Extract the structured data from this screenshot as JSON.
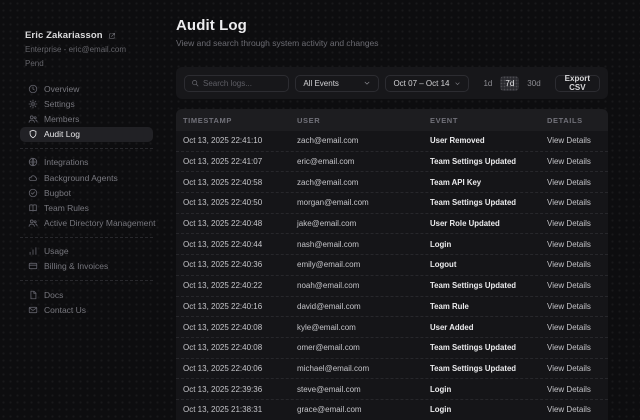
{
  "colors": {
    "page_bg": "#0d0d0f",
    "card_bg": "#17171a",
    "table_bg": "#151518",
    "table_header_bg": "#1d1d20",
    "active_item_bg": "#212125",
    "text_primary": "#ededef",
    "text_muted": "#6b6b72"
  },
  "sidebar": {
    "profile": {
      "name": "Eric Zakariasson",
      "org": "Enterprise - eric@email.com",
      "plan": "Pend"
    },
    "groups": [
      {
        "items": [
          {
            "label": "Overview",
            "icon": "clock-icon"
          },
          {
            "label": "Settings",
            "icon": "gear-icon"
          },
          {
            "label": "Members",
            "icon": "users-icon"
          },
          {
            "label": "Audit Log",
            "icon": "shield-icon",
            "active": true
          }
        ]
      },
      {
        "items": [
          {
            "label": "Integrations",
            "icon": "globe-icon"
          },
          {
            "label": "Background Agents",
            "icon": "cloud-icon"
          },
          {
            "label": "Bugbot",
            "icon": "check-circle-icon"
          },
          {
            "label": "Team Rules",
            "icon": "book-icon"
          },
          {
            "label": "Active Directory Management",
            "icon": "users-icon"
          }
        ]
      },
      {
        "items": [
          {
            "label": "Usage",
            "icon": "bar-chart-icon"
          },
          {
            "label": "Billing & Invoices",
            "icon": "credit-card-icon"
          }
        ]
      },
      {
        "items": [
          {
            "label": "Docs",
            "icon": "file-icon"
          },
          {
            "label": "Contact Us",
            "icon": "mail-icon"
          }
        ]
      }
    ]
  },
  "header": {
    "title": "Audit Log",
    "subtitle": "View and search through system activity and changes"
  },
  "toolbar": {
    "search_placeholder": "Search logs...",
    "event_filter_value": "All Events",
    "date_range": "Oct 07 – Oct 14",
    "range_buttons": [
      "1d",
      "7d",
      "30d"
    ],
    "active_range": "7d",
    "export_label": "Export CSV"
  },
  "table": {
    "columns": [
      "Timestamp",
      "User",
      "Event",
      "Details"
    ],
    "details_label": "View Details",
    "rows": [
      {
        "timestamp": "Oct 13, 2025 22:41:10",
        "user": "zach@email.com",
        "event": "User Removed"
      },
      {
        "timestamp": "Oct 13, 2025 22:41:07",
        "user": "eric@email.com",
        "event": "Team Settings Updated"
      },
      {
        "timestamp": "Oct 13, 2025 22:40:58",
        "user": "zach@email.com",
        "event": "Team API Key"
      },
      {
        "timestamp": "Oct 13, 2025 22:40:50",
        "user": "morgan@email.com",
        "event": "Team Settings Updated"
      },
      {
        "timestamp": "Oct 13, 2025 22:40:48",
        "user": "jake@email.com",
        "event": "User Role Updated"
      },
      {
        "timestamp": "Oct 13, 2025 22:40:44",
        "user": "nash@email.com",
        "event": "Login"
      },
      {
        "timestamp": "Oct 13, 2025 22:40:36",
        "user": "emily@email.com",
        "event": "Logout"
      },
      {
        "timestamp": "Oct 13, 2025 22:40:22",
        "user": "noah@email.com",
        "event": "Team Settings Updated"
      },
      {
        "timestamp": "Oct 13, 2025 22:40:16",
        "user": "david@email.com",
        "event": "Team Rule"
      },
      {
        "timestamp": "Oct 13, 2025 22:40:08",
        "user": "kyle@email.com",
        "event": "User Added"
      },
      {
        "timestamp": "Oct 13, 2025 22:40:08",
        "user": "omer@email.com",
        "event": "Team Settings Updated"
      },
      {
        "timestamp": "Oct 13, 2025 22:40:06",
        "user": "michael@email.com",
        "event": "Team Settings Updated"
      },
      {
        "timestamp": "Oct 13, 2025 22:39:36",
        "user": "steve@email.com",
        "event": "Login"
      },
      {
        "timestamp": "Oct 13, 2025 21:38:31",
        "user": "grace@email.com",
        "event": "Login"
      }
    ]
  }
}
